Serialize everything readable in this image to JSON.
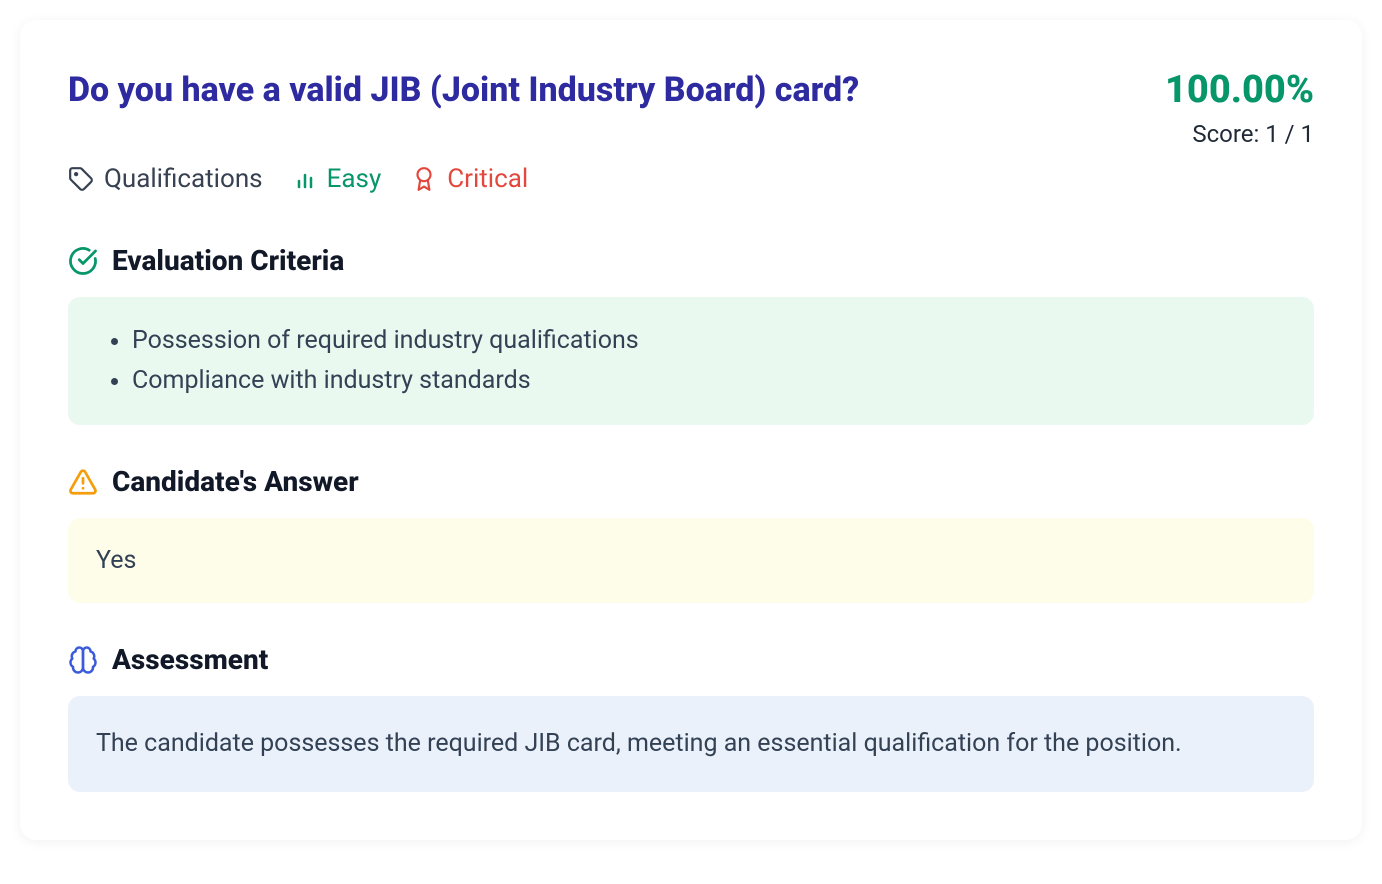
{
  "header": {
    "question": "Do you have a valid JIB (Joint Industry Board) card?",
    "score_pct": "100.00%",
    "score_detail": "Score: 1 / 1"
  },
  "meta": {
    "category": "Qualifications",
    "difficulty": "Easy",
    "priority": "Critical"
  },
  "criteria": {
    "title": "Evaluation Criteria",
    "items": [
      "Possession of required industry qualifications",
      "Compliance with industry standards"
    ]
  },
  "answer": {
    "title": "Candidate's Answer",
    "text": "Yes"
  },
  "assessment": {
    "title": "Assessment",
    "text": "The candidate possesses the required JIB card, meeting an essential qualification for the position."
  }
}
